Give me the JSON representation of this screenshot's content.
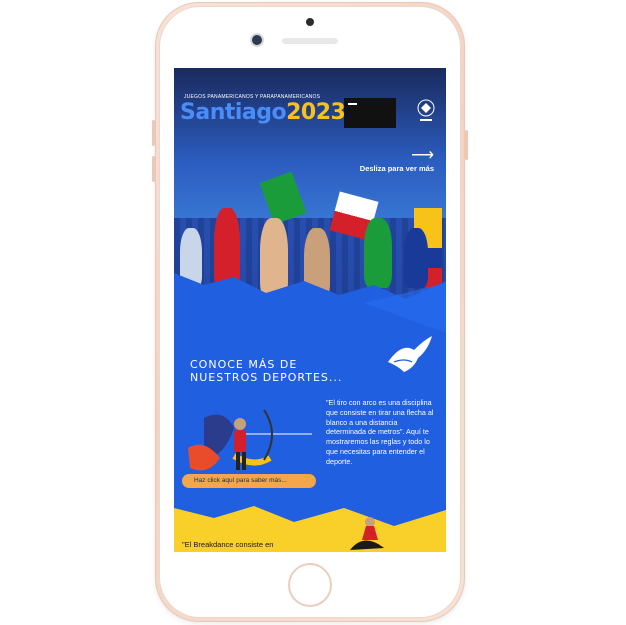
{
  "hero": {
    "logo_tagline": "JUEGOS PANAMERICANOS Y PARAPANAMERICANOS",
    "logo_word_left": "Santiago",
    "logo_word_right": "2023",
    "swipe_label": "Desliza para ver más",
    "carousel_dots": 3,
    "carousel_active": 1
  },
  "sports": {
    "section_title_line1": "CONOCE MÁS DE",
    "section_title_line2": "NUESTROS DEPORTES...",
    "archery_description": "\"El tiro con arco es una disciplina que consiste en tirar una flecha al blanco a una distancia determinada de metros\". Aquí te mostraremos las reglas y todo lo que necesitas para entender el deporte.",
    "cta_label": "Haz click aquí para saber más...",
    "breakdance_teaser": "\"El Breakdance consiste en"
  },
  "colors": {
    "primary_blue": "#1f5fe0",
    "cta_orange": "#f5a64a",
    "yellow": "#f9cf2a",
    "phone_frame": "#f2d3c3"
  }
}
